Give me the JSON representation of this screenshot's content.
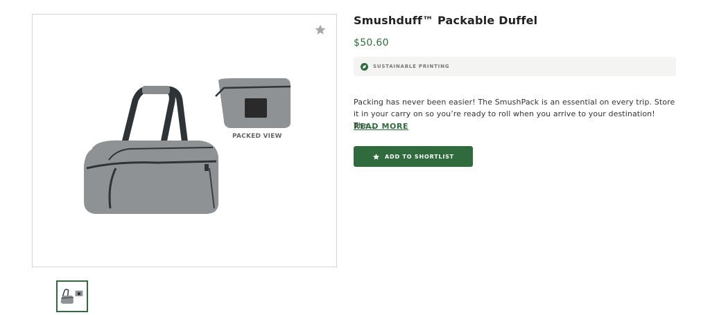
{
  "product": {
    "title": "Smushduff™ Packable Duffel",
    "price": "$50.60",
    "badge": {
      "label": "SUSTAINABLE PRINTING",
      "icon": "leaf-icon",
      "icon_color": "#2f6b3c"
    },
    "description": "Packing has never been easier! The SmushPack is an essential on every trip. Store it in your carry on so you’re ready to roll when you arrive to your destination! The...",
    "read_more_label": "READ MORE",
    "shortlist_label": "ADD TO SHORTLIST",
    "accent_color": "#2f6b3c"
  },
  "gallery": {
    "packed_view_label": "PACKED VIEW",
    "favorite_icon": "star-icon"
  }
}
